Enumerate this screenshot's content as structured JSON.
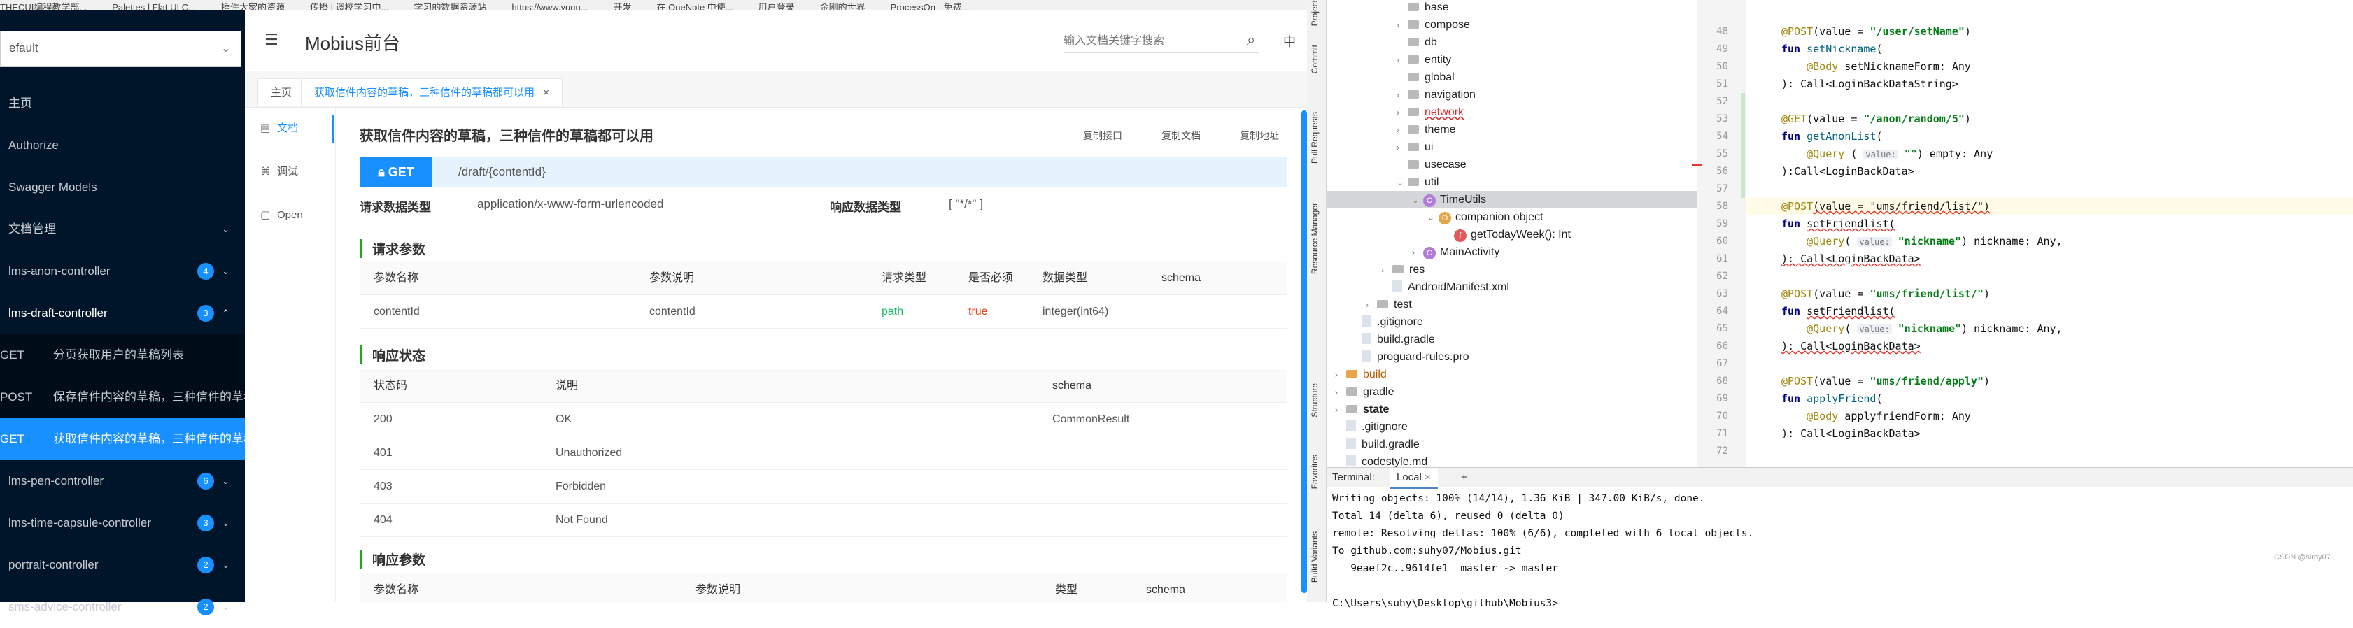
{
  "bookmarks": [
    "THECUI编程教学部...",
    "Palettes | Flat UI C...",
    "插件大家的资源",
    "传播 | 调校学习中...",
    "学习的数据资源站",
    "https://www.yuqu...",
    "开发",
    "在 OneNote 中使...",
    "用户登录",
    "金刚的世界",
    "ProcessOn - 免费..."
  ],
  "swagger": {
    "group_select": "efault",
    "app_title": "Mobius前台",
    "search_placeholder": "输入文档关键字搜索",
    "lang_label": "中",
    "menu": [
      {
        "label": "主页"
      },
      {
        "label": "Authorize"
      },
      {
        "label": "Swagger Models"
      },
      {
        "label": "文档管理"
      },
      {
        "label": "lms-anon-controller",
        "count": "4"
      },
      {
        "label": "lms-draft-controller",
        "count": "3"
      }
    ],
    "sub_menu": [
      {
        "method": "GET",
        "label": "分页获取用户的草稿列表"
      },
      {
        "method": "POST",
        "label": "保存信件内容的草稿，三种信件的草稿都可以用"
      },
      {
        "method": "GET",
        "label": "获取信件内容的草稿，三种信件的草稿都可以用"
      }
    ],
    "menu_after": [
      {
        "label": "lms-pen-controller",
        "count": "6"
      },
      {
        "label": "lms-time-capsule-controller",
        "count": "3"
      },
      {
        "label": "portrait-controller",
        "count": "2"
      },
      {
        "label": "sms-advice-controller",
        "count": "2"
      }
    ],
    "tabs": {
      "home": "主页",
      "active": "获取信件内容的草稿，三种信件的草稿都可以用",
      "close": "×"
    },
    "left_nav": [
      {
        "icon": "doc-icon",
        "label": "文档",
        "glyph": "▤"
      },
      {
        "icon": "debug-icon",
        "label": "调试",
        "glyph": "⌘"
      },
      {
        "icon": "open-icon",
        "label": "Open",
        "glyph": "▢"
      }
    ],
    "api": {
      "title": "获取信件内容的草稿，三种信件的草稿都可以用",
      "copy_interface": "复制接口",
      "copy_doc": "复制文档",
      "copy_url": "复制地址",
      "method": "GET",
      "path": "/draft/{contentId}",
      "req_type_label": "请求数据类型",
      "req_type_value": "application/x-www-form-urlencoded",
      "resp_type_label": "响应数据类型",
      "resp_type_value": "[ \"*/*\" ]"
    },
    "req_params": {
      "title": "请求参数",
      "headers": [
        "参数名称",
        "参数说明",
        "请求类型",
        "是否必须",
        "数据类型",
        "schema"
      ],
      "rows": [
        [
          "contentId",
          "contentId",
          "path",
          "true",
          "integer(int64)",
          ""
        ]
      ]
    },
    "resp_status": {
      "title": "响应状态",
      "headers": [
        "状态码",
        "说明",
        "schema"
      ],
      "rows": [
        [
          "200",
          "OK",
          "CommonResult"
        ],
        [
          "401",
          "Unauthorized",
          ""
        ],
        [
          "403",
          "Forbidden",
          ""
        ],
        [
          "404",
          "Not Found",
          ""
        ]
      ]
    },
    "resp_params": {
      "title": "响应参数",
      "headers": [
        "参数名称",
        "参数说明",
        "类型",
        "schema"
      ]
    },
    "colors": {
      "sidebar": "#001529",
      "accent": "#1890ff",
      "green": "#1aad19",
      "path": "#19be6b",
      "required": "#ed4014"
    }
  },
  "ide": {
    "side_tabs": [
      "Project",
      "Commit",
      "Pull Requests",
      "Resource Manager",
      "Structure",
      "Favorites",
      "Build Variants"
    ],
    "tree": [
      {
        "label": "base",
        "depth": 5,
        "kind": "folder"
      },
      {
        "label": "compose",
        "depth": 5,
        "kind": "folder",
        "arrow": "›"
      },
      {
        "label": "db",
        "depth": 5,
        "kind": "folder"
      },
      {
        "label": "entity",
        "depth": 5,
        "kind": "folder",
        "arrow": "›"
      },
      {
        "label": "global",
        "depth": 5,
        "kind": "folder"
      },
      {
        "label": "navigation",
        "depth": 5,
        "kind": "folder",
        "arrow": "›"
      },
      {
        "label": "network",
        "depth": 5,
        "kind": "folder",
        "arrow": "›",
        "err": true
      },
      {
        "label": "theme",
        "depth": 5,
        "kind": "folder",
        "arrow": "›"
      },
      {
        "label": "ui",
        "depth": 5,
        "kind": "folder",
        "arrow": "›"
      },
      {
        "label": "usecase",
        "depth": 5,
        "kind": "folder"
      },
      {
        "label": "util",
        "depth": 5,
        "kind": "folder",
        "arrow": "⌄"
      },
      {
        "label": "TimeUtils",
        "depth": 6,
        "kind": "kotlin",
        "arrow": "⌄",
        "sel": true
      },
      {
        "label": "companion object",
        "depth": 7,
        "kind": "obj",
        "arrow": "⌄"
      },
      {
        "label": "getTodayWeek(): Int",
        "depth": 8,
        "kind": "fun"
      },
      {
        "label": "MainActivity",
        "depth": 6,
        "kind": "kotlin",
        "arrow": "›"
      },
      {
        "label": "res",
        "depth": 4,
        "kind": "folder",
        "arrow": "›"
      },
      {
        "label": "AndroidManifest.xml",
        "depth": 4,
        "kind": "file"
      },
      {
        "label": "test",
        "depth": 3,
        "kind": "folder",
        "arrow": "›"
      },
      {
        "label": ".gitignore",
        "depth": 2,
        "kind": "file"
      },
      {
        "label": "build.gradle",
        "depth": 2,
        "kind": "file"
      },
      {
        "label": "proguard-rules.pro",
        "depth": 2,
        "kind": "file"
      },
      {
        "label": "build",
        "depth": 1,
        "kind": "folder",
        "arrow": "›",
        "orange": true
      },
      {
        "label": "gradle",
        "depth": 1,
        "kind": "folder",
        "arrow": "›"
      },
      {
        "label": "state",
        "depth": 1,
        "kind": "folder",
        "arrow": "›",
        "bold": true
      },
      {
        "label": ".gitignore",
        "depth": 1,
        "kind": "file"
      },
      {
        "label": "build.gradle",
        "depth": 1,
        "kind": "file"
      },
      {
        "label": "codestyle.md",
        "depth": 1,
        "kind": "file"
      }
    ],
    "line_numbers": [
      "48",
      "49",
      "50",
      "51",
      "52",
      "53",
      "54",
      "55",
      "56",
      "57",
      "58",
      "59",
      "60",
      "61",
      "62",
      "63",
      "64",
      "65",
      "66",
      "67",
      "68",
      "69",
      "70",
      "71",
      "72"
    ],
    "code": [
      [
        [
          "an",
          "@POST"
        ],
        [
          "",
          "(value = "
        ],
        [
          "str",
          "\"/user/setName\""
        ],
        [
          "",
          ")"
        ]
      ],
      [
        [
          "kw",
          "fun "
        ],
        [
          "fn",
          "setNickname"
        ],
        [
          "",
          "("
        ]
      ],
      [
        [
          "",
          "    "
        ],
        [
          "an",
          "@Body"
        ],
        [
          "",
          " setNicknameForm: Any"
        ]
      ],
      [
        [
          "",
          "): Call<LoginBackDataString>"
        ]
      ],
      [
        [
          "",
          ""
        ]
      ],
      [
        [
          "an",
          "@GET"
        ],
        [
          "",
          "(value = "
        ],
        [
          "str",
          "\"/anon/random/5\""
        ],
        [
          "",
          ")"
        ]
      ],
      [
        [
          "kw",
          "fun "
        ],
        [
          "fn",
          "getAnonList"
        ],
        [
          "",
          "("
        ]
      ],
      [
        [
          "",
          "    "
        ],
        [
          "an",
          "@Query"
        ],
        [
          "",
          " ( "
        ],
        [
          "hint",
          "value:"
        ],
        [
          "str",
          " \"\""
        ],
        [
          "",
          ") empty: Any"
        ]
      ],
      [
        [
          "",
          "):Call<LoginBackData>"
        ]
      ],
      [
        [
          "",
          ""
        ]
      ],
      [
        [
          "an",
          "@POST"
        ],
        [
          "wavy",
          "(value = \"ums/friend/list/\")"
        ]
      ],
      [
        [
          "kw",
          "fun "
        ],
        [
          "wavy",
          "setFriendlist("
        ]
      ],
      [
        [
          "",
          "    "
        ],
        [
          "an",
          "@Query"
        ],
        [
          "",
          "( "
        ],
        [
          "hint",
          "value:"
        ],
        [
          "str",
          " \"nickname\""
        ],
        [
          "",
          ") nickname: Any,"
        ]
      ],
      [
        [
          "wavy",
          "): Call<LoginBackData>"
        ]
      ],
      [
        [
          "",
          ""
        ]
      ],
      [
        [
          "an",
          "@POST"
        ],
        [
          "",
          "(value = "
        ],
        [
          "str",
          "\"ums/friend/list/\""
        ],
        [
          "",
          ")"
        ]
      ],
      [
        [
          "kw",
          "fun "
        ],
        [
          "wavy",
          "setFriendlist("
        ]
      ],
      [
        [
          "",
          "    "
        ],
        [
          "an",
          "@Query"
        ],
        [
          "",
          "( "
        ],
        [
          "hint",
          "value:"
        ],
        [
          "str",
          " \"nickname\""
        ],
        [
          "",
          ") nickname: Any,"
        ]
      ],
      [
        [
          "wavy",
          "): Call<LoginBackData>"
        ]
      ],
      [
        [
          "",
          ""
        ]
      ],
      [
        [
          "an",
          "@POST"
        ],
        [
          "",
          "(value = "
        ],
        [
          "str",
          "\"ums/friend/apply\""
        ],
        [
          "",
          ")"
        ]
      ],
      [
        [
          "kw",
          "fun "
        ],
        [
          "fn",
          "applyFriend"
        ],
        [
          "",
          "("
        ]
      ],
      [
        [
          "",
          "    "
        ],
        [
          "an",
          "@Body"
        ],
        [
          "",
          " applyfriendForm: Any"
        ]
      ],
      [
        [
          "",
          "): Call<LoginBackData>"
        ]
      ],
      [
        [
          "",
          ""
        ]
      ]
    ],
    "terminal": {
      "label": "Terminal:",
      "tab": "Local",
      "add": "+",
      "lines": [
        "Writing objects: 100% (14/14), 1.36 KiB | 347.00 KiB/s, done.",
        "Total 14 (delta 6), reused 0 (delta 0)",
        "remote: Resolving deltas: 100% (6/6), completed with 6 local objects.",
        "To github.com:suhy07/Mobius.git",
        "   9eaef2c..9614fe1  master -> master",
        "",
        "C:\\Users\\suhy\\Desktop\\github\\Mobius3>"
      ]
    },
    "watermark": "CSDN @suhy07"
  }
}
